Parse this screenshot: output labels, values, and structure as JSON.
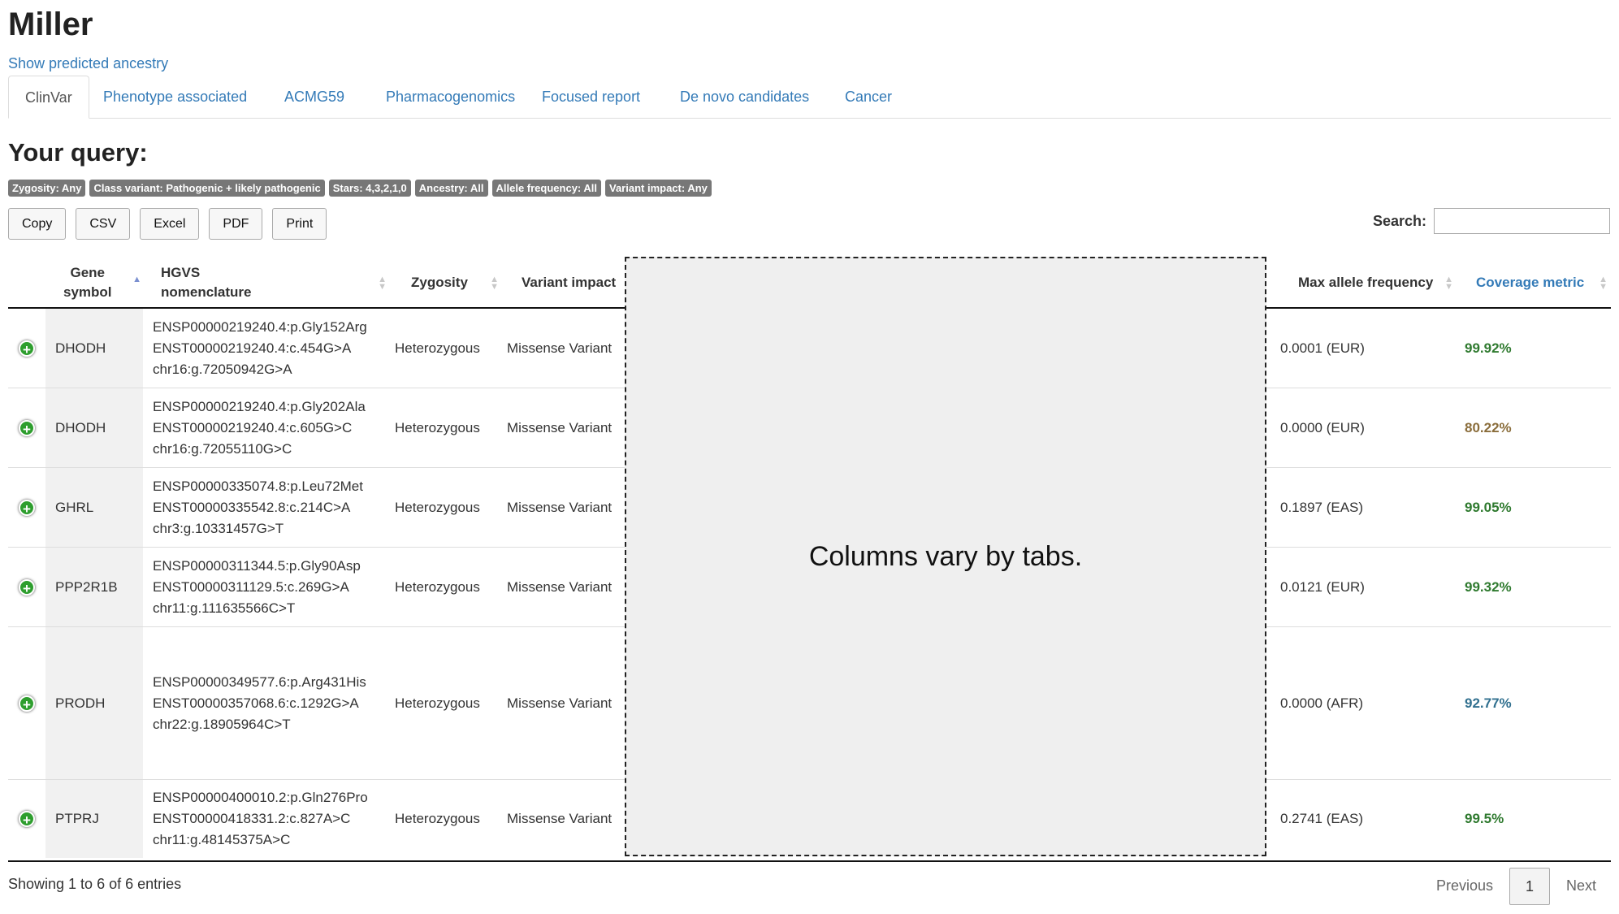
{
  "title": "Miller",
  "ancestry_link": "Show predicted ancestry",
  "tabs": [
    {
      "label": "ClinVar",
      "active": true
    },
    {
      "label": "Phenotype associated"
    },
    {
      "label": "ACMG59"
    },
    {
      "label": "Pharmacogenomics"
    },
    {
      "label": "Focused report"
    },
    {
      "label": "De novo candidates"
    },
    {
      "label": "Cancer"
    }
  ],
  "query_heading": "Your query:",
  "filters": [
    "Zygosity: Any",
    "Class variant: Pathogenic + likely pathogenic",
    "Stars: 4,3,2,1,0",
    "Ancestry: All",
    "Allele frequency: All",
    "Variant impact: Any"
  ],
  "export_buttons": [
    "Copy",
    "CSV",
    "Excel",
    "PDF",
    "Print"
  ],
  "search_label": "Search:",
  "columns": {
    "gene": [
      "Gene",
      "symbol"
    ],
    "hgvs": [
      "HGVS",
      "nomenclature"
    ],
    "zygosity": "Zygosity",
    "impact": "Variant impact",
    "maxaf": "Max allele frequency",
    "coverage": "Coverage metric"
  },
  "placeholder_text": "Columns vary by tabs.",
  "rows": [
    {
      "gene": "DHODH",
      "hgvs": [
        "ENSP00000219240.4:p.Gly152Arg",
        "ENST00000219240.4:c.454G>A",
        "chr16:g.72050942G>A"
      ],
      "zygosity": "Heterozygous",
      "impact": "Missense Variant",
      "maxaf": "0.0001 (EUR)",
      "coverage": "99.92%"
    },
    {
      "gene": "DHODH",
      "hgvs": [
        "ENSP00000219240.4:p.Gly202Ala",
        "ENST00000219240.4:c.605G>C",
        "chr16:g.72055110G>C"
      ],
      "zygosity": "Heterozygous",
      "impact": "Missense Variant",
      "maxaf": "0.0000 (EUR)",
      "coverage": "80.22%"
    },
    {
      "gene": "GHRL",
      "hgvs": [
        "ENSP00000335074.8:p.Leu72Met",
        "ENST00000335542.8:c.214C>A",
        "chr3:g.10331457G>T"
      ],
      "zygosity": "Heterozygous",
      "impact": "Missense Variant",
      "maxaf": "0.1897 (EAS)",
      "coverage": "99.05%"
    },
    {
      "gene": "PPP2R1B",
      "hgvs": [
        "ENSP00000311344.5:p.Gly90Asp",
        "ENST00000311129.5:c.269G>A",
        "chr11:g.111635566C>T"
      ],
      "zygosity": "Heterozygous",
      "impact": "Missense Variant",
      "maxaf": "0.0121 (EUR)",
      "coverage": "99.32%"
    },
    {
      "gene": "PRODH",
      "hgvs": [
        "ENSP00000349577.6:p.Arg431His",
        "ENST00000357068.6:c.1292G>A",
        "chr22:g.18905964C>T"
      ],
      "zygosity": "Heterozygous",
      "impact": "Missense Variant",
      "maxaf": "0.0000 (AFR)",
      "coverage": "92.77%"
    },
    {
      "gene": "PTPRJ",
      "hgvs": [
        "ENSP00000400010.2:p.Gln276Pro",
        "ENST00000418331.2:c.827A>C",
        "chr11:g.48145375A>C"
      ],
      "zygosity": "Heterozygous",
      "impact": "Missense Variant",
      "maxaf": "0.2741 (EAS)",
      "coverage": "99.5%"
    }
  ],
  "coverage_colors": {
    "high": "#2f7a2f",
    "medium": "#8a6d3b",
    "mid": "#31708f"
  },
  "coverage_levels": [
    "high",
    "medium",
    "high",
    "high",
    "mid",
    "high"
  ],
  "info": "Showing 1 to 6 of 6 entries",
  "pagination": {
    "previous": "Previous",
    "current": "1",
    "next": "Next"
  }
}
